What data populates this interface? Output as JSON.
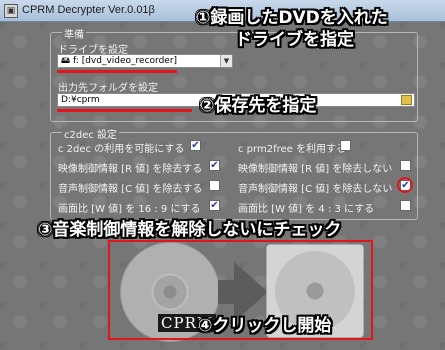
{
  "window": {
    "title": "CPRM Decrypter Ver.0.01β"
  },
  "prep": {
    "group_title": "準備",
    "drive_label": "ドライブを設定",
    "drive_value": "f: [dvd_video_recorder]",
    "output_label": "出力先フォルダを設定",
    "output_value": "D:¥cprm"
  },
  "c2dec": {
    "group_title": "c2dec 設定",
    "options": [
      {
        "label": "c 2dec の利用を可能にする",
        "checked": true
      },
      {
        "label": "c prm2free を利用する",
        "checked": false
      },
      {
        "label": "映像制御情報 [R 値] を除去する",
        "checked": true
      },
      {
        "label": "映像制御情報 [R 値] を除去しない",
        "checked": false
      },
      {
        "label": "音声制御情報 [C 値] を除去する",
        "checked": false
      },
      {
        "label": "音声制御情報 [C 値] を除去しない",
        "checked": true
      },
      {
        "label": "画面比 [W 値] を 16 : 9 にする",
        "checked": true
      },
      {
        "label": "画面比 [W 値] を 4 : 3 にする",
        "checked": false
      }
    ],
    "check_mark": "✔"
  },
  "start_button": {
    "label": "CPRM"
  },
  "annotations": {
    "a1_line1": "①録画したDVDを入れた",
    "a1_line2": "ドライブを指定",
    "a2": "②保存先を指定",
    "a3": "③音楽制御情報を解除しないにチェック",
    "a4": "④クリックし開始"
  },
  "colors": {
    "highlight": "#e0161c",
    "panel": "#767676"
  }
}
